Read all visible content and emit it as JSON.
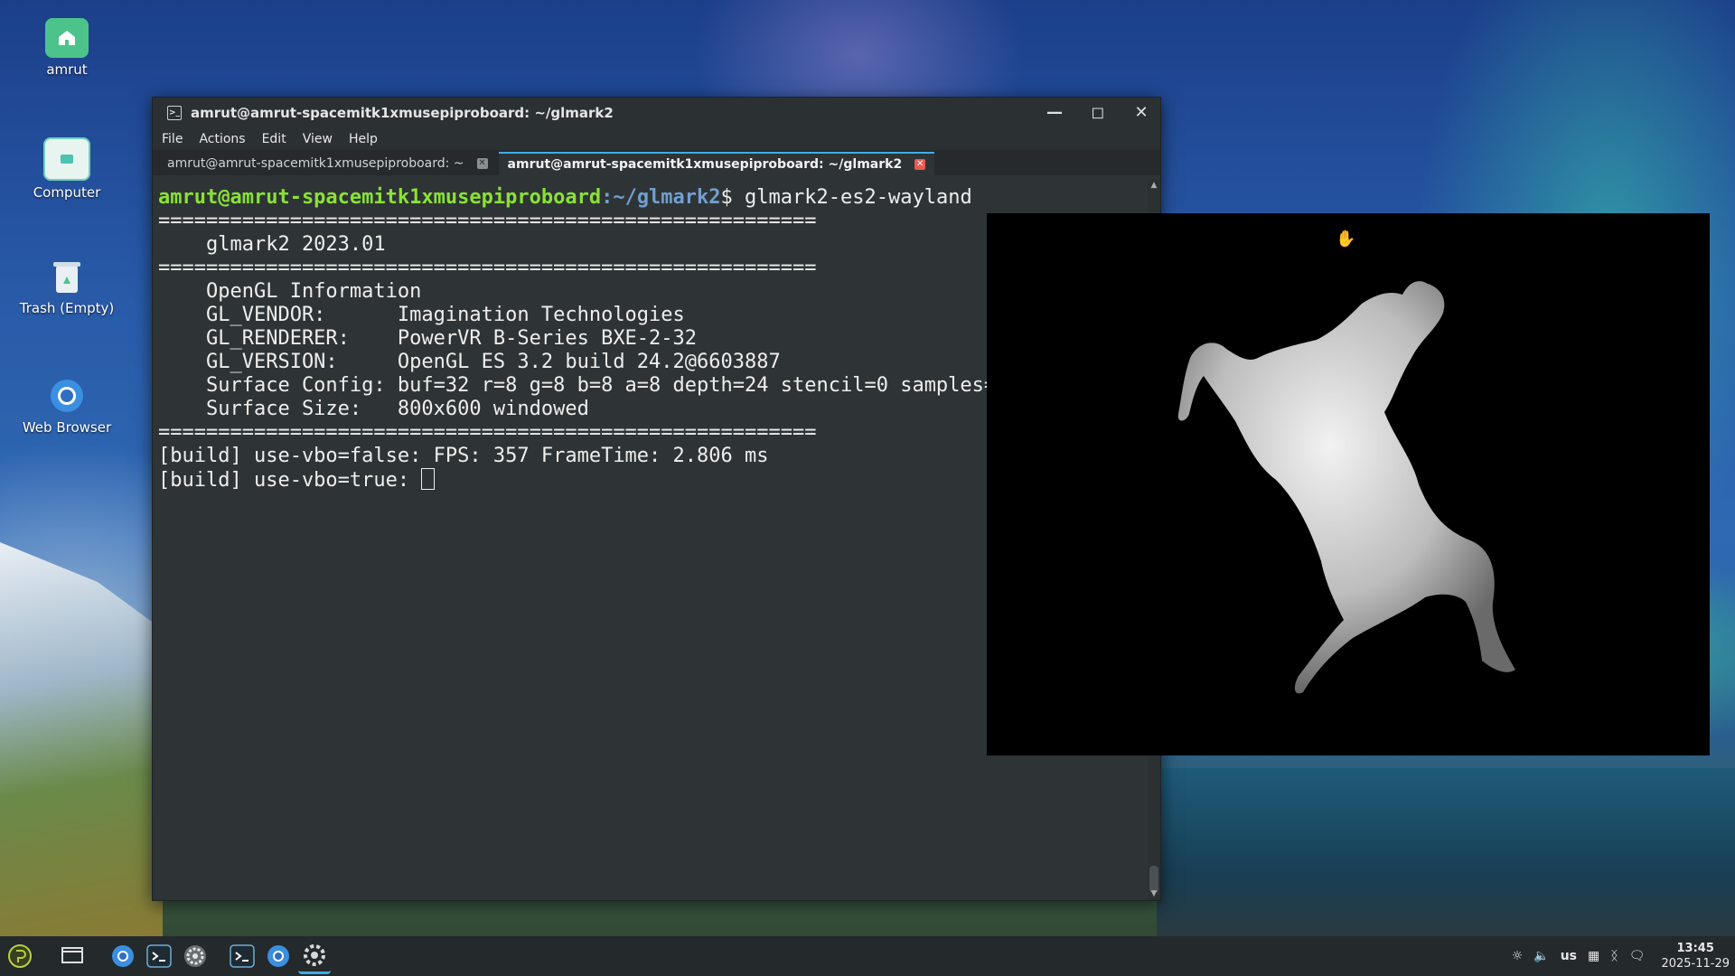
{
  "desktop": {
    "icons": [
      {
        "label": "amrut",
        "icon": "home-folder-icon"
      },
      {
        "label": "Computer",
        "icon": "computer-icon"
      },
      {
        "label": "Trash (Empty)",
        "icon": "trash-icon"
      },
      {
        "label": "Web Browser",
        "icon": "web-browser-icon"
      }
    ]
  },
  "terminal": {
    "title": "amrut@amrut-spacemitk1xmusepiproboard: ~/glmark2",
    "menu": [
      "File",
      "Actions",
      "Edit",
      "View",
      "Help"
    ],
    "tabs": [
      {
        "label": "amrut@amrut-spacemitk1xmusepiproboard: ~",
        "active": false
      },
      {
        "label": "amrut@amrut-spacemitk1xmusepiproboard: ~/glmark2",
        "active": true
      }
    ],
    "prompt_user": "amrut@amrut-spacemitk1xmusepiproboard",
    "prompt_path": ":~/glmark2",
    "prompt_symbol": "$ ",
    "command": "glmark2-es2-wayland",
    "lines": [
      "=======================================================",
      "    glmark2 2023.01",
      "=======================================================",
      "    OpenGL Information",
      "    GL_VENDOR:      Imagination Technologies",
      "    GL_RENDERER:    PowerVR B-Series BXE-2-32",
      "    GL_VERSION:     OpenGL ES 3.2 build 24.2@6603887",
      "    Surface Config: buf=32 r=8 g=8 b=8 a=8 depth=24 stencil=0 samples=0",
      "    Surface Size:   800x600 windowed",
      "=======================================================",
      "[build] use-vbo=false: FPS: 357 FrameTime: 2.806 ms"
    ],
    "current_line": "[build] use-vbo=true: "
  },
  "taskbar": {
    "keyboard_layout": "us",
    "time": "13:45",
    "date": "2025-11-29"
  }
}
